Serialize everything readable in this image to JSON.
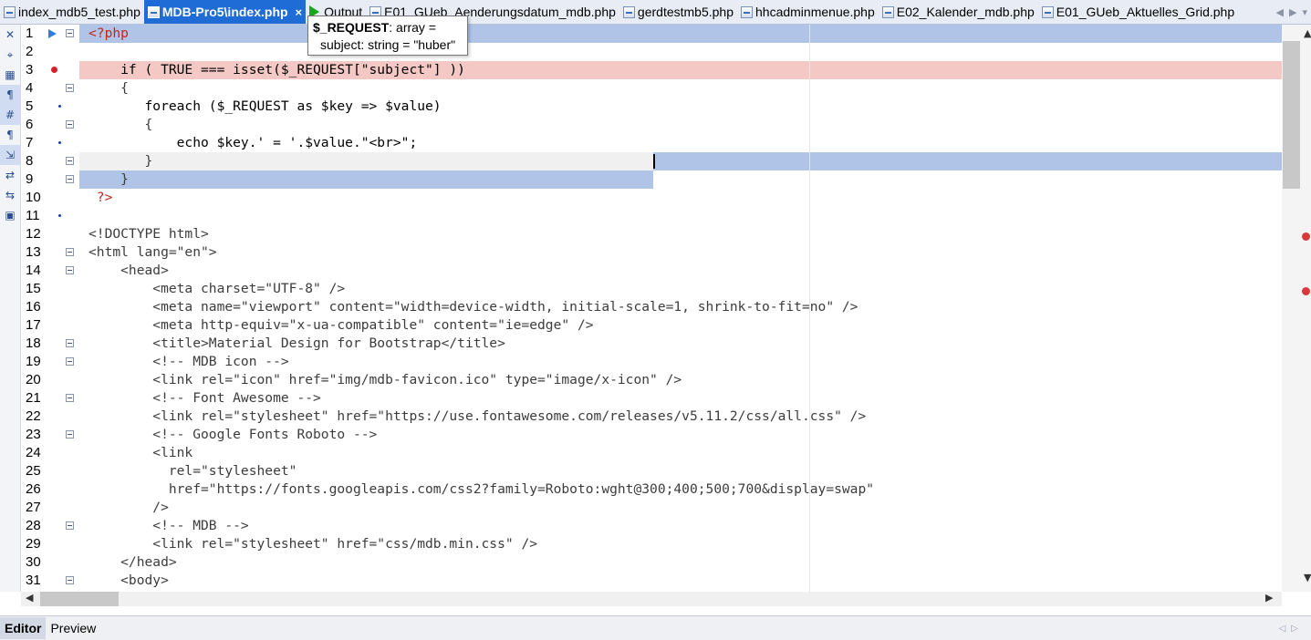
{
  "tabs": [
    {
      "label": "index_mdb5_test.php",
      "active": false
    },
    {
      "label": "MDB-Pro5\\index.php",
      "active": true,
      "close": "×"
    },
    {
      "label": "Output",
      "type": "output"
    },
    {
      "label": "E01_GUeb_Aenderungsdatum_mdb.php"
    },
    {
      "label": "gerdtestmb5.php"
    },
    {
      "label": "hhcadminmenue.php"
    },
    {
      "label": "E02_Kalender_mdb.php"
    },
    {
      "label": "E01_GUeb_Aktuelles_Grid.php"
    }
  ],
  "tab_nav": {
    "prev": "◀",
    "next": "▶",
    "menu": "▾"
  },
  "tooltip": {
    "name": "$_REQUEST",
    "type_text": ": array =",
    "detail": "subject: string = \"huber\""
  },
  "left_tools": [
    "✕",
    "⌖",
    "▦",
    "¶",
    "#",
    "¶",
    "⇲",
    "⇄",
    "⇆",
    "▣"
  ],
  "code_lines": [
    "<?php",
    "",
    "    if ( TRUE === isset($_REQUEST[\"subject\"] ))",
    "    {",
    "       foreach ($_REQUEST as $key => $value)",
    "       {",
    "           echo $key.' = '.$value.\"<br>\";",
    "       }",
    "    }",
    " ?>",
    "",
    "<!DOCTYPE html>",
    "<html lang=\"en\">",
    "    <head>",
    "        <meta charset=\"UTF-8\" />",
    "        <meta name=\"viewport\" content=\"width=device-width, initial-scale=1, shrink-to-fit=no\" />",
    "        <meta http-equiv=\"x-ua-compatible\" content=\"ie=edge\" />",
    "        <title>Material Design for Bootstrap</title>",
    "        <!-- MDB icon -->",
    "        <link rel=\"icon\" href=\"img/mdb-favicon.ico\" type=\"image/x-icon\" />",
    "        <!-- Font Awesome -->",
    "        <link rel=\"stylesheet\" href=\"https://use.fontawesome.com/releases/v5.11.2/css/all.css\" />",
    "        <!-- Google Fonts Roboto -->",
    "        <link",
    "          rel=\"stylesheet\"",
    "          href=\"https://fonts.googleapis.com/css2?family=Roboto:wght@300;400;500;700&display=swap\"",
    "        />",
    "        <!-- MDB -->",
    "        <link rel=\"stylesheet\" href=\"css/mdb.min.css\" />",
    "    </head>",
    "    <body>"
  ],
  "bottom_tabs": [
    {
      "label": "Editor",
      "active": true
    },
    {
      "label": "Preview",
      "active": false
    }
  ],
  "scroll": {
    "up": "▲",
    "down": "▼",
    "left": "◀",
    "right": "▶"
  }
}
